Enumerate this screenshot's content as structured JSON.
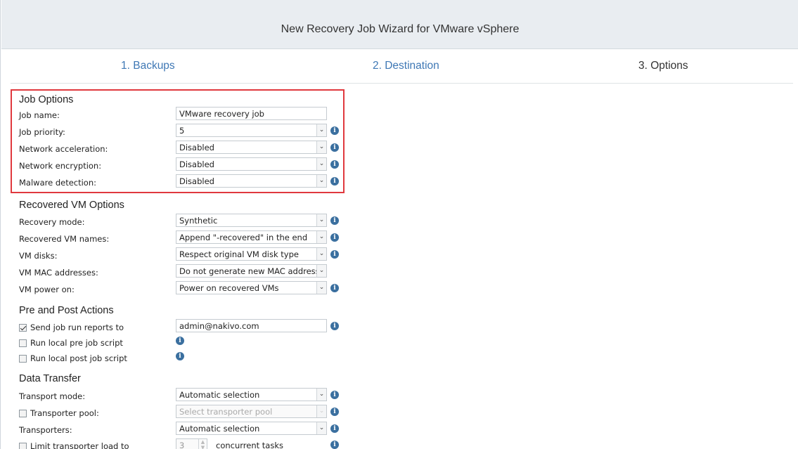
{
  "wizard": {
    "title": "New Recovery Job Wizard for VMware vSphere"
  },
  "steps": [
    {
      "label": "1. Backups"
    },
    {
      "label": "2. Destination"
    },
    {
      "label": "3. Options"
    }
  ],
  "job_options": {
    "heading": "Job Options",
    "job_name": {
      "label": "Job name:",
      "value": "VMware recovery job"
    },
    "job_priority": {
      "label": "Job priority:",
      "value": "5"
    },
    "network_acceleration": {
      "label": "Network acceleration:",
      "value": "Disabled"
    },
    "network_encryption": {
      "label": "Network encryption:",
      "value": "Disabled"
    },
    "malware_detection": {
      "label": "Malware detection:",
      "value": "Disabled"
    }
  },
  "recovered_vm_options": {
    "heading": "Recovered VM Options",
    "recovery_mode": {
      "label": "Recovery mode:",
      "value": "Synthetic"
    },
    "recovered_vm_names": {
      "label": "Recovered VM names:",
      "value": "Append \"-recovered\" in the end"
    },
    "vm_disks": {
      "label": "VM disks:",
      "value": "Respect original VM disk type"
    },
    "vm_mac_addresses": {
      "label": "VM MAC addresses:",
      "value": "Do not generate new MAC addresses"
    },
    "vm_power_on": {
      "label": "VM power on:",
      "value": "Power on recovered VMs"
    }
  },
  "pre_post_actions": {
    "heading": "Pre and Post Actions",
    "send_reports": {
      "label": "Send job run reports to",
      "checked": true,
      "value": "admin@nakivo.com"
    },
    "pre_script": {
      "label": "Run local pre job script",
      "checked": false
    },
    "post_script": {
      "label": "Run local post job script",
      "checked": false
    }
  },
  "data_transfer": {
    "heading": "Data Transfer",
    "transport_mode": {
      "label": "Transport mode:",
      "value": "Automatic selection"
    },
    "transporter_pool": {
      "label": "Transporter pool:",
      "checked": false,
      "placeholder": "Select transporter pool"
    },
    "transporters": {
      "label": "Transporters:",
      "value": "Automatic selection"
    },
    "limit_load": {
      "label": "Limit transporter load to",
      "checked": false,
      "value": "3",
      "suffix": "concurrent tasks"
    }
  },
  "icons": {
    "info": "info-icon",
    "dropdown": "chevron-down-icon",
    "checkbox": "checkbox-icon",
    "spinner": "spinner-arrows-icon"
  },
  "colors": {
    "step_link": "#3f78b5",
    "highlight_border": "#e0393e",
    "info_icon": "#3a6f9f",
    "header_bg": "#e9edf1"
  }
}
